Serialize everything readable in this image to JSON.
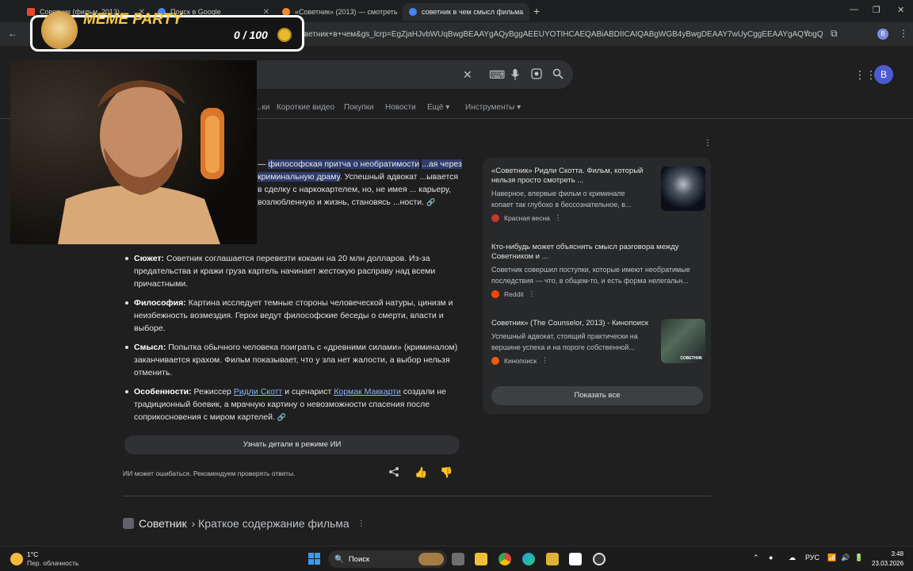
{
  "browser": {
    "tabs": [
      {
        "title": "Советник (фильм, 2013)",
        "active": false
      },
      {
        "title": "Поиск в Google",
        "active": false
      },
      {
        "title": "«Советник» (2013) — смотреть",
        "active": false
      },
      {
        "title": "советник в чем смысл фильма",
        "active": true
      }
    ],
    "new_tab": "+",
    "window_controls": {
      "minimize": "—",
      "maximize": "❐",
      "close": "✕"
    },
    "url": "...оветник+в+чем&gs_lcrp=EgZjaHJvbWUqBwgBEAAYgAQyBggAEEUYOTIHCAEQABiABDIICAIQABgWGB4yBwgDEAAY7wUyCggEEAAYgAQYogQyBwgF...",
    "profile_initial": "B"
  },
  "search": {
    "clear_icon": "✕",
    "apps_icon": "⋮⋮⋮",
    "avatar_initial": "B",
    "tabs": [
      "...ки",
      "Короткие видео",
      "Покупки",
      "Новости",
      "Ещё ▾",
      "Инструменты ▾"
    ]
  },
  "ai_overview": {
    "intro_prefix": "— ",
    "intro_highlight_1": "философская притча о необратимости",
    "intro_highlight_2": "...ая через криминальную драму",
    "intro_rest": ". Успешный адвокат ...ывается в сделку с наркокартелем, но, не имея ... карьеру, возлюбленную и жизнь, становясь ...ности.",
    "bullets": [
      {
        "term": "Сюжет:",
        "text": " Советник соглашается перевезти кокаин на 20 млн долларов. Из-за предательства и кражи груза картель начинает жестокую расправу над всеми причастными."
      },
      {
        "term": "Философия:",
        "text": " Картина исследует темные стороны человеческой натуры, цинизм и неизбежность возмездия. Герои ведут философские беседы о смерти, власти и выборе."
      },
      {
        "term": "Смысл:",
        "text": " Попытка обычного человека поиграть с «древними силами» (криминалом) заканчивается крахом. Фильм показывает, что у зла нет жалости, а выбор нельзя отменить."
      },
      {
        "term": "Особенности:",
        "text_1": " Режиссер ",
        "link_1": "Ридли Скотт",
        "text_2": " и сценарист ",
        "link_2": "Кормак Маккарти",
        "text_3": " создали не традиционный боевик, а мрачную картину о невозможности спасения после соприкосновения с миром картелей."
      }
    ],
    "dive_button": "Узнать детали в режиме ИИ",
    "disclaimer": "ИИ может ошибаться. Рекомендуем проверять ответы."
  },
  "sources": {
    "items": [
      {
        "title": "«Советник» Ридли Скотта. Фильм, который нельзя просто смотреть ...",
        "snippet": "Наверное, впервые фильм о криминале копает так глубоко в бессознательное, в...",
        "site": "Красная весна"
      },
      {
        "title": "Кто-нибудь может объяснить смысл разговора между Советником и ...",
        "snippet": "Советник совершил поступки, которые имеют необратимые последствия — что, в общем-то, и есть форма нелегальн...",
        "site": "Reddit"
      },
      {
        "title": "Советник» (The Counselor, 2013) - Кинопоиск",
        "snippet": "Успешный адвокат, стоящий практически на вершине успеха и на пороге собственной...",
        "site": "Кинопоиск",
        "thumb_caption": "СОВЕТНИК"
      }
    ],
    "show_all": "Показать все"
  },
  "result": {
    "site": "Советник",
    "breadcrumb": " › Краткое содержание фильма"
  },
  "overlay": {
    "title": "MEME PARTY",
    "score": "0 / 100"
  },
  "taskbar": {
    "weather_temp": "1°C",
    "weather_desc": "Пер. облачность",
    "search_label": "Поиск",
    "lang": "РУС",
    "time": "3:48",
    "date": "23.03.2026"
  },
  "colors": {
    "page_bg": "#1f1f1f",
    "panel_bg": "#28292a",
    "link": "#8ab4f8",
    "highlight": "#2f3c6b",
    "meme_yellow": "#f7c948"
  }
}
